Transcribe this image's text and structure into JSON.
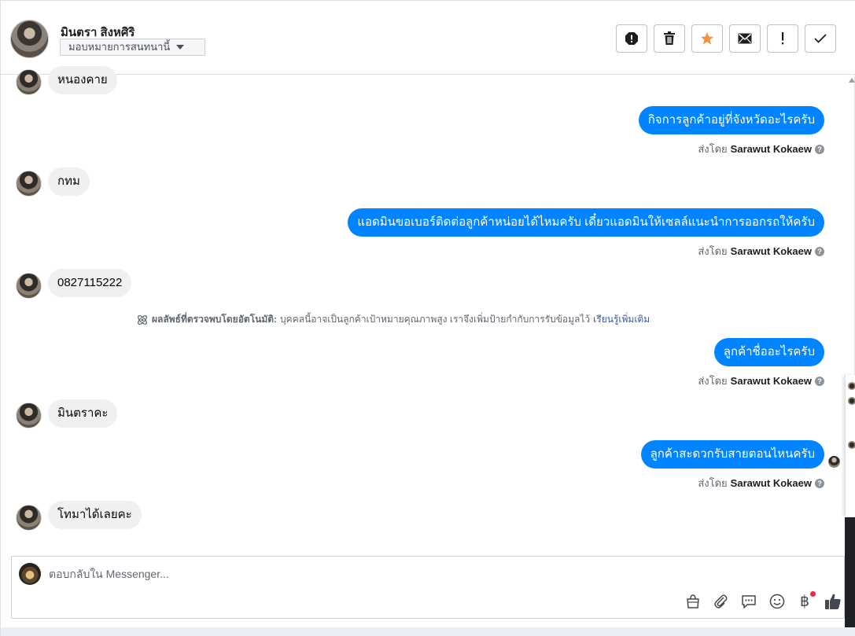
{
  "header": {
    "contact_name": "มินตรา สิงหศิริ",
    "assign_label": "มอบหมายการสนทนานี้"
  },
  "actions": [
    {
      "name": "spam-icon",
      "color": "#1c1e21"
    },
    {
      "name": "trash-icon",
      "color": "#1c1e21"
    },
    {
      "name": "star-icon",
      "color": "#f7923a"
    },
    {
      "name": "mail-icon",
      "color": "#1c1e21"
    },
    {
      "name": "exclamation-icon",
      "color": "#1c1e21"
    },
    {
      "name": "check-icon",
      "color": "#1c1e21"
    }
  ],
  "messages": [
    {
      "from": "customer",
      "text": "หนองคาย"
    },
    {
      "from": "page",
      "text": "กิจการลูกค้าอยู่ที่จังหวัดอะไรครับ",
      "sent_by_prefix": "ส่งโดย",
      "sent_by": "Sarawut Kokaew"
    },
    {
      "from": "customer",
      "text": "กทม"
    },
    {
      "from": "page",
      "text": "แอดมินขอเบอร์ติดต่อลูกค้าหน่อยได้ไหมครับ เดี๋ยวแอดมินให้เซลล์แนะนำการออกรถให้ครับ",
      "sent_by_prefix": "ส่งโดย",
      "sent_by": "Sarawut Kokaew"
    },
    {
      "from": "customer",
      "text": "0827115222"
    },
    {
      "from": "page",
      "text": "ลูกค้าชื่ออะไรครับ",
      "sent_by_prefix": "ส่งโดย",
      "sent_by": "Sarawut Kokaew"
    },
    {
      "from": "customer",
      "text": "มินตราคะ"
    },
    {
      "from": "page",
      "text": "ลูกค้าสะดวกรับสายตอนไหนครับ",
      "sent_by_prefix": "ส่งโดย",
      "sent_by": "Sarawut Kokaew"
    },
    {
      "from": "customer",
      "text": "โทมาได้เลยคะ"
    }
  ],
  "auto_note": {
    "label": "ผลลัพธ์ที่ตรวจพบโดยอัตโนมัติ:",
    "text": "บุคคลนี้อาจเป็นลูกค้าเป้าหมายคุณภาพสูง เราจึงเพิ่มป้ายกำกับการรับข้อมูลไว้",
    "link": "เรียนรู้เพิ่มเติม"
  },
  "composer": {
    "placeholder": "ตอบกลับใน Messenger...",
    "tools": [
      "shop-bag-icon",
      "paperclip-icon",
      "quick-reply-icon",
      "emoji-icon",
      "baht-icon",
      "thumbs-up-icon"
    ],
    "baht_symbol": "฿",
    "accent": "#0084ff"
  },
  "help_mark": "?"
}
